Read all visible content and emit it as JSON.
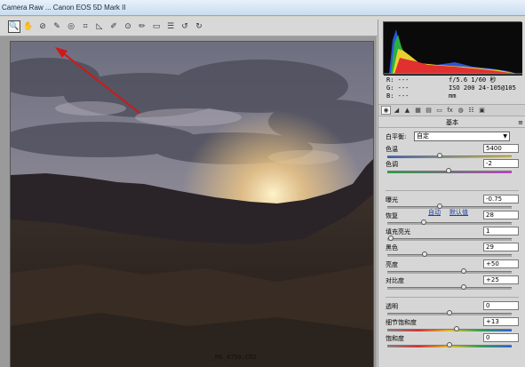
{
  "window": {
    "title": "Camera Raw ... Canon EOS 5D Mark II"
  },
  "toolbar": {
    "tools": [
      {
        "name": "zoom-tool",
        "glyph": "🔍"
      },
      {
        "name": "hand-tool",
        "glyph": "✋"
      },
      {
        "name": "white-balance-tool",
        "glyph": "⊘"
      },
      {
        "name": "color-sampler-tool",
        "glyph": "✎"
      },
      {
        "name": "targeted-adjustment-tool",
        "glyph": "◎"
      },
      {
        "name": "crop-tool",
        "glyph": "⌗"
      },
      {
        "name": "straighten-tool",
        "glyph": "◺"
      },
      {
        "name": "spot-removal-tool",
        "glyph": "✐"
      },
      {
        "name": "red-eye-tool",
        "glyph": "⊙"
      },
      {
        "name": "adjustment-brush-tool",
        "glyph": "✏"
      },
      {
        "name": "graduated-filter-tool",
        "glyph": "▭"
      },
      {
        "name": "preferences-tool",
        "glyph": "☰"
      },
      {
        "name": "rotate-ccw-tool",
        "glyph": "↺"
      },
      {
        "name": "rotate-cw-tool",
        "glyph": "↻"
      }
    ]
  },
  "preview": {
    "filename": "_MG_4759.CR2"
  },
  "histogram_info": {
    "r": "R:  ---",
    "g": "G:  ---",
    "b": "B:  ---",
    "exposure": "f/5.6  1/60 秒",
    "iso": "ISO 200  24-105@105 mm"
  },
  "panel": {
    "section_title": "基本",
    "white_balance": {
      "label": "白平衡:",
      "value": "自定"
    },
    "auto_label": "自动",
    "default_label": "默认值",
    "sliders": [
      {
        "key": "temperature",
        "label": "色温",
        "value": "5400",
        "level": 0.42
      },
      {
        "key": "tint",
        "label": "色调",
        "value": "-2",
        "level": 0.49
      },
      {
        "key": "exposure",
        "label": "曝光",
        "value": "-0.75",
        "level": 0.42
      },
      {
        "key": "recovery",
        "label": "恢复",
        "value": "28",
        "level": 0.28
      },
      {
        "key": "fill-light",
        "label": "填充亮光",
        "value": "1",
        "level": 0.01
      },
      {
        "key": "blacks",
        "label": "黑色",
        "value": "29",
        "level": 0.29
      },
      {
        "key": "brightness",
        "label": "亮度",
        "value": "+50",
        "level": 0.62
      },
      {
        "key": "contrast",
        "label": "对比度",
        "value": "+25",
        "level": 0.62
      },
      {
        "key": "clarity",
        "label": "透明",
        "value": "0",
        "level": 0.5
      },
      {
        "key": "vibrance",
        "label": "细节饱和度",
        "value": "+13",
        "level": 0.56
      },
      {
        "key": "saturation",
        "label": "饱和度",
        "value": "0",
        "level": 0.5
      }
    ]
  },
  "colors": {
    "annotation_arrow": "#d01818"
  }
}
